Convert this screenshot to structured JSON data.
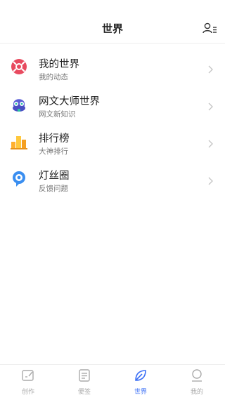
{
  "header": {
    "title": "世界",
    "friends_icon": "user-list-icon"
  },
  "items": [
    {
      "name": "我的世界",
      "sub": "我的动态",
      "icon": "lifebuoy-icon"
    },
    {
      "name": "网文大师世界",
      "sub": "网文新知识",
      "icon": "mascot-icon"
    },
    {
      "name": "排行榜",
      "sub": "大神排行",
      "icon": "ranking-bars-icon"
    },
    {
      "name": "灯丝圈",
      "sub": "反馈问题",
      "icon": "chat-bubble-icon"
    }
  ],
  "tabs": [
    {
      "label": "创作",
      "icon": "write-icon",
      "active": false
    },
    {
      "label": "便签",
      "icon": "note-icon",
      "active": false
    },
    {
      "label": "世界",
      "icon": "leaf-icon",
      "active": true
    },
    {
      "label": "我的",
      "icon": "profile-icon",
      "active": false
    }
  ],
  "colors": {
    "accent": "#3b6ff5",
    "inactive": "#aaaaaa"
  }
}
